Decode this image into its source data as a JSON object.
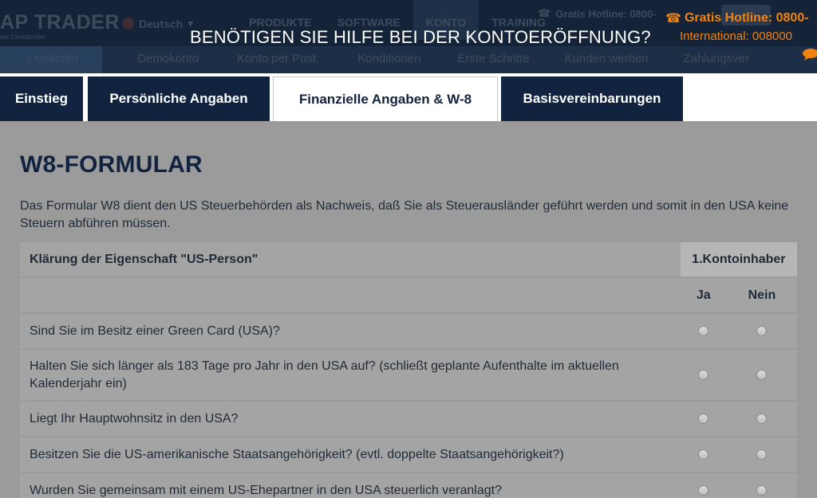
{
  "site": {
    "logo": "AP TRADER",
    "logo_sub": "der Direktbroker",
    "language": "Deutsch",
    "topnav": [
      "PRODUKTE",
      "SOFTWARE",
      "KONTO",
      "TRAINING"
    ],
    "topnav_active": 2,
    "hotline_bg": "Gratis Hotline: 0800-",
    "subnav": [
      "Livekonto",
      "Demokonto",
      "Konto per Post",
      "Konditionen",
      "Erste Schritte",
      "Kunden werben",
      "Zahlungsver"
    ]
  },
  "overlay": {
    "help_title": "BENÖTIGEN SIE HILFE BEI DER KONTOERÖFFNUNG?",
    "hotline": "Gratis Hotline: 0800-",
    "international": "International: 008000"
  },
  "tabs": [
    {
      "label": "Einstieg",
      "active": false
    },
    {
      "label": "Persönliche Angaben",
      "active": false
    },
    {
      "label": "Finanzielle Angaben & W-8",
      "active": true
    },
    {
      "label": "Basisvereinbarungen",
      "active": false
    }
  ],
  "form": {
    "title": "W8-FORMULAR",
    "description": "Das Formular W8 dient den US Steuerbehörden als Nachweis, daß Sie als Steuerausländer geführt werden und somit in den USA keine Steuern abführen müssen.",
    "table": {
      "header_question": "Klärung der Eigenschaft \"US-Person\"",
      "header_holder": "1.Kontoinhaber",
      "yes": "Ja",
      "no": "Nein",
      "questions": [
        "Sind Sie im Besitz einer Green Card (USA)?",
        "Halten Sie sich länger als 183 Tage pro Jahr in den USA auf? (schließt geplante Aufenthalte im aktuellen Kalenderjahr ein)",
        "Liegt Ihr Hauptwohnsitz in den USA?",
        "Besitzen Sie die US-amerikanische Staatsangehörigkeit? (evtl. doppelte Staatsangehörigkeit?)",
        "Wurden Sie gemeinsam mit einem US-Ehepartner in den USA steuerlich veranlagt?"
      ]
    }
  },
  "colors": {
    "navy": "#122340",
    "accent_orange": "#f0820f",
    "overlay_gray": "#9b9b9b"
  }
}
